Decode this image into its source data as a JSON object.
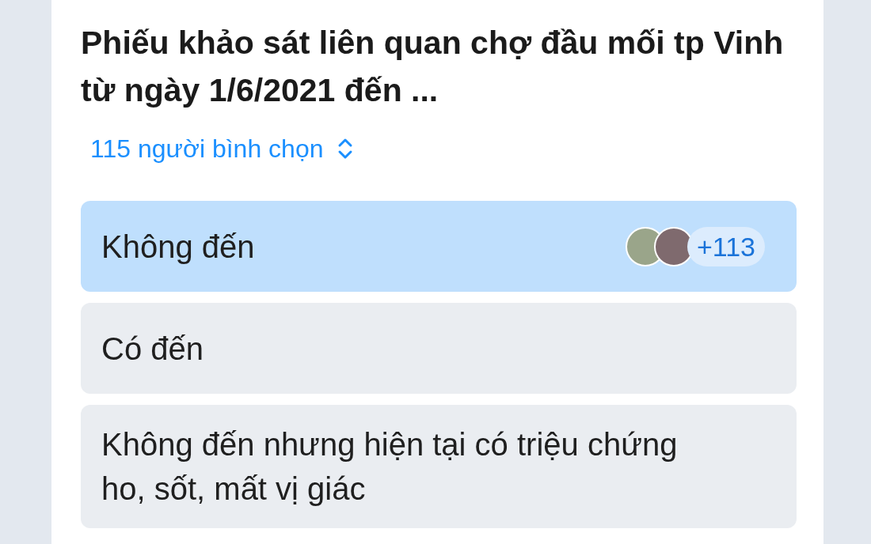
{
  "poll": {
    "title": "Phiếu khảo sát liên quan chợ đầu mối tp Vinh từ ngày 1/6/2021 đến ...",
    "voters_link": "115 người bình chọn",
    "options": [
      {
        "label": "Không đến",
        "selected": true,
        "voter_badge": "+113"
      },
      {
        "label": "Có đến",
        "selected": false
      },
      {
        "label": "Không đến nhưng hiện tại có triệu chứng ho, sốt, mất vị giác",
        "selected": false
      }
    ]
  }
}
